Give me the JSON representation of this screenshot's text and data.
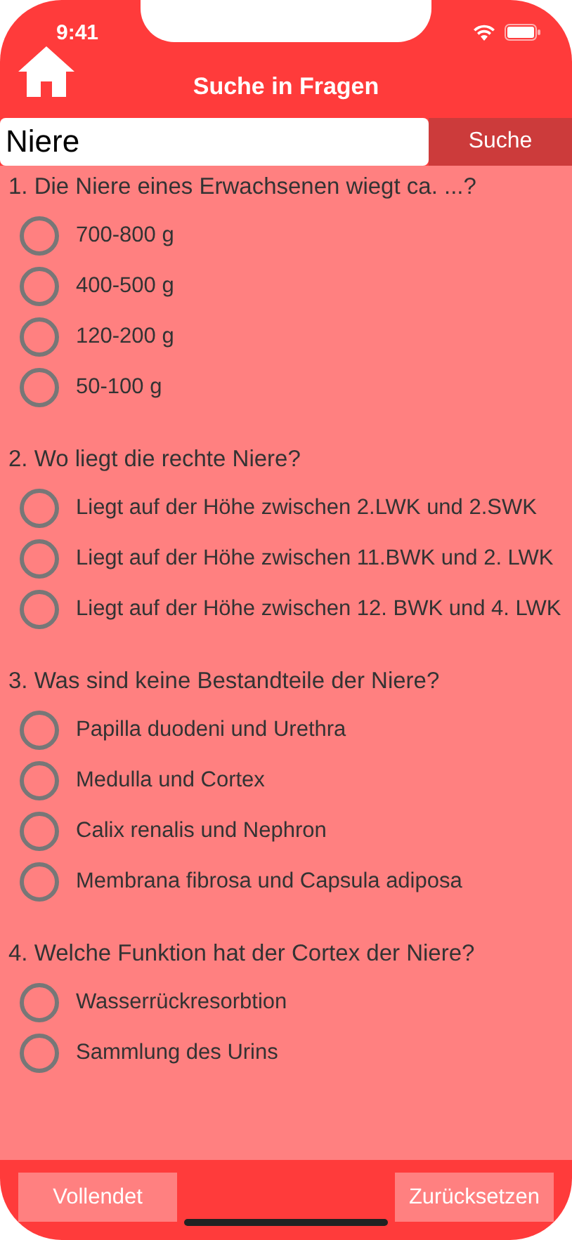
{
  "status_bar": {
    "time": "9:41"
  },
  "header": {
    "title": "Suche in Fragen"
  },
  "search": {
    "value": "Niere",
    "button": "Suche"
  },
  "questions": [
    {
      "text": "1. Die Niere eines Erwachsenen wiegt ca. ...?",
      "options": [
        {
          "label": "700-800 g",
          "selected": false
        },
        {
          "label": "400-500 g",
          "selected": false
        },
        {
          "label": "120-200 g",
          "selected": false
        },
        {
          "label": "50-100 g",
          "selected": false
        }
      ]
    },
    {
      "text": "2. Wo liegt die rechte Niere?",
      "options": [
        {
          "label": "Liegt auf der Höhe zwischen 2.LWK und 2.SWK",
          "selected": false
        },
        {
          "label": "Liegt auf der Höhe zwischen 11.BWK und 2. LWK",
          "selected": false
        },
        {
          "label": "Liegt auf der Höhe zwischen 12. BWK und 4. LWK",
          "selected": false
        }
      ]
    },
    {
      "text": "3. Was sind keine Bestandteile der Niere?",
      "options": [
        {
          "label": "Papilla duodeni und Urethra",
          "selected": false
        },
        {
          "label": "Medulla und Cortex",
          "selected": false
        },
        {
          "label": "Calix renalis und Nephron",
          "selected": false
        },
        {
          "label": "Membrana fibrosa und Capsula adiposa",
          "selected": false
        }
      ]
    },
    {
      "text": "4. Welche Funktion hat der Cortex der Niere?",
      "options": [
        {
          "label": "Wasserrückresorbtion",
          "selected": false
        },
        {
          "label": "Sammlung des Urins",
          "selected": false
        }
      ]
    }
  ],
  "footer": {
    "buttons": [
      "Vollendet",
      "Zurücksetzen"
    ]
  }
}
